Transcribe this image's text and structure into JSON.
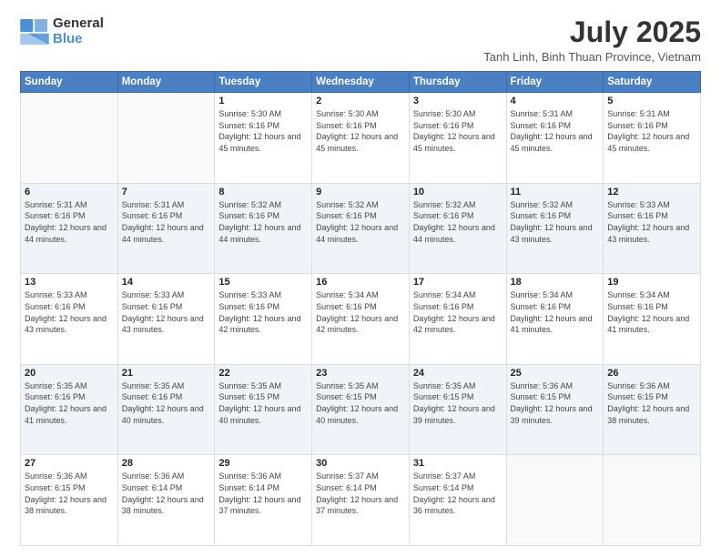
{
  "header": {
    "logo_line1": "General",
    "logo_line2": "Blue",
    "month_year": "July 2025",
    "location": "Tanh Linh, Binh Thuan Province, Vietnam"
  },
  "days_of_week": [
    "Sunday",
    "Monday",
    "Tuesday",
    "Wednesday",
    "Thursday",
    "Friday",
    "Saturday"
  ],
  "weeks": [
    [
      {
        "day": "",
        "detail": ""
      },
      {
        "day": "",
        "detail": ""
      },
      {
        "day": "1",
        "detail": "Sunrise: 5:30 AM\nSunset: 6:16 PM\nDaylight: 12 hours and 45 minutes."
      },
      {
        "day": "2",
        "detail": "Sunrise: 5:30 AM\nSunset: 6:16 PM\nDaylight: 12 hours and 45 minutes."
      },
      {
        "day": "3",
        "detail": "Sunrise: 5:30 AM\nSunset: 6:16 PM\nDaylight: 12 hours and 45 minutes."
      },
      {
        "day": "4",
        "detail": "Sunrise: 5:31 AM\nSunset: 6:16 PM\nDaylight: 12 hours and 45 minutes."
      },
      {
        "day": "5",
        "detail": "Sunrise: 5:31 AM\nSunset: 6:16 PM\nDaylight: 12 hours and 45 minutes."
      }
    ],
    [
      {
        "day": "6",
        "detail": "Sunrise: 5:31 AM\nSunset: 6:16 PM\nDaylight: 12 hours and 44 minutes."
      },
      {
        "day": "7",
        "detail": "Sunrise: 5:31 AM\nSunset: 6:16 PM\nDaylight: 12 hours and 44 minutes."
      },
      {
        "day": "8",
        "detail": "Sunrise: 5:32 AM\nSunset: 6:16 PM\nDaylight: 12 hours and 44 minutes."
      },
      {
        "day": "9",
        "detail": "Sunrise: 5:32 AM\nSunset: 6:16 PM\nDaylight: 12 hours and 44 minutes."
      },
      {
        "day": "10",
        "detail": "Sunrise: 5:32 AM\nSunset: 6:16 PM\nDaylight: 12 hours and 44 minutes."
      },
      {
        "day": "11",
        "detail": "Sunrise: 5:32 AM\nSunset: 6:16 PM\nDaylight: 12 hours and 43 minutes."
      },
      {
        "day": "12",
        "detail": "Sunrise: 5:33 AM\nSunset: 6:16 PM\nDaylight: 12 hours and 43 minutes."
      }
    ],
    [
      {
        "day": "13",
        "detail": "Sunrise: 5:33 AM\nSunset: 6:16 PM\nDaylight: 12 hours and 43 minutes."
      },
      {
        "day": "14",
        "detail": "Sunrise: 5:33 AM\nSunset: 6:16 PM\nDaylight: 12 hours and 43 minutes."
      },
      {
        "day": "15",
        "detail": "Sunrise: 5:33 AM\nSunset: 6:16 PM\nDaylight: 12 hours and 42 minutes."
      },
      {
        "day": "16",
        "detail": "Sunrise: 5:34 AM\nSunset: 6:16 PM\nDaylight: 12 hours and 42 minutes."
      },
      {
        "day": "17",
        "detail": "Sunrise: 5:34 AM\nSunset: 6:16 PM\nDaylight: 12 hours and 42 minutes."
      },
      {
        "day": "18",
        "detail": "Sunrise: 5:34 AM\nSunset: 6:16 PM\nDaylight: 12 hours and 41 minutes."
      },
      {
        "day": "19",
        "detail": "Sunrise: 5:34 AM\nSunset: 6:16 PM\nDaylight: 12 hours and 41 minutes."
      }
    ],
    [
      {
        "day": "20",
        "detail": "Sunrise: 5:35 AM\nSunset: 6:16 PM\nDaylight: 12 hours and 41 minutes."
      },
      {
        "day": "21",
        "detail": "Sunrise: 5:35 AM\nSunset: 6:16 PM\nDaylight: 12 hours and 40 minutes."
      },
      {
        "day": "22",
        "detail": "Sunrise: 5:35 AM\nSunset: 6:15 PM\nDaylight: 12 hours and 40 minutes."
      },
      {
        "day": "23",
        "detail": "Sunrise: 5:35 AM\nSunset: 6:15 PM\nDaylight: 12 hours and 40 minutes."
      },
      {
        "day": "24",
        "detail": "Sunrise: 5:35 AM\nSunset: 6:15 PM\nDaylight: 12 hours and 39 minutes."
      },
      {
        "day": "25",
        "detail": "Sunrise: 5:36 AM\nSunset: 6:15 PM\nDaylight: 12 hours and 39 minutes."
      },
      {
        "day": "26",
        "detail": "Sunrise: 5:36 AM\nSunset: 6:15 PM\nDaylight: 12 hours and 38 minutes."
      }
    ],
    [
      {
        "day": "27",
        "detail": "Sunrise: 5:36 AM\nSunset: 6:15 PM\nDaylight: 12 hours and 38 minutes."
      },
      {
        "day": "28",
        "detail": "Sunrise: 5:36 AM\nSunset: 6:14 PM\nDaylight: 12 hours and 38 minutes."
      },
      {
        "day": "29",
        "detail": "Sunrise: 5:36 AM\nSunset: 6:14 PM\nDaylight: 12 hours and 37 minutes."
      },
      {
        "day": "30",
        "detail": "Sunrise: 5:37 AM\nSunset: 6:14 PM\nDaylight: 12 hours and 37 minutes."
      },
      {
        "day": "31",
        "detail": "Sunrise: 5:37 AM\nSunset: 6:14 PM\nDaylight: 12 hours and 36 minutes."
      },
      {
        "day": "",
        "detail": ""
      },
      {
        "day": "",
        "detail": ""
      }
    ]
  ]
}
